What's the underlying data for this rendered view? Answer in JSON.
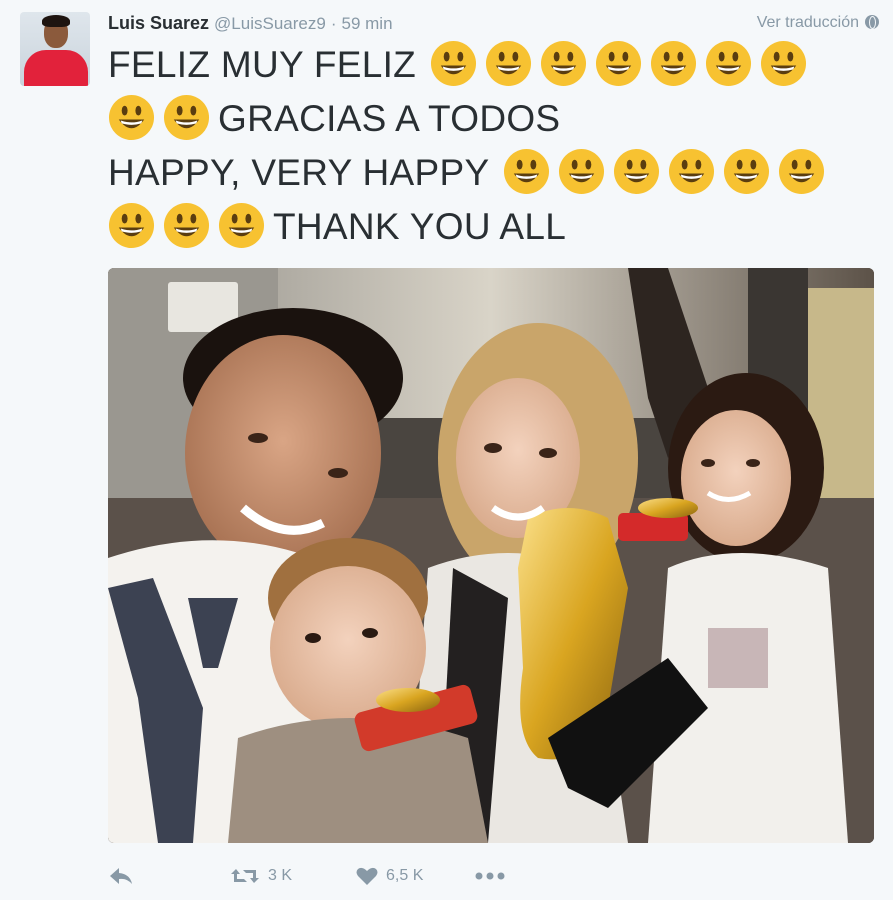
{
  "tweet": {
    "author": {
      "name": "Luis Suarez",
      "handle": "@LuisSuarez9",
      "separator": "·",
      "time": "59 min"
    },
    "translate_label": "Ver traducción",
    "translate_icon": "globe-icon",
    "text_lines": [
      {
        "text": "FELIZ MUY FELIZ",
        "emoji_before": 0,
        "emoji_after": 7
      },
      {
        "text": "GRACIAS A TODOS",
        "emoji_before": 2,
        "emoji_after": 0
      },
      {
        "text": "HAPPY, VERY HAPPY",
        "emoji_before": 0,
        "emoji_after": 6
      },
      {
        "text": "THANK YOU ALL",
        "emoji_before": 3,
        "emoji_after": 0
      }
    ],
    "emoji_icon": "grinning-face-emoji",
    "media": {
      "type": "photo",
      "subject": "family selfie with golden boot trophy"
    },
    "actions": {
      "reply_icon": "reply-icon",
      "retweet_icon": "retweet-icon",
      "retweet_count": "3 K",
      "like_icon": "heart-icon",
      "like_count": "6,5 K",
      "more_icon": "more-icon"
    },
    "colors": {
      "background": "#f5f8fa",
      "text": "#292f33",
      "muted": "#8899a6",
      "emoji_face": "#f7c231"
    }
  }
}
